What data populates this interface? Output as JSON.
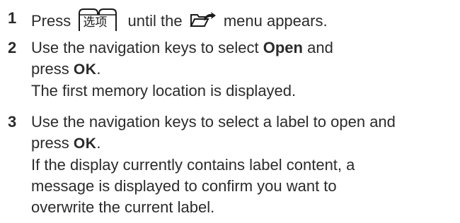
{
  "steps": [
    {
      "number": "1",
      "parts": {
        "before": "Press",
        "key_text": "选项",
        "after": "until the",
        "end": "menu appears."
      }
    },
    {
      "number": "2",
      "lines": {
        "pre": "Use the navigation keys to select",
        "open": "Open",
        "post": "and",
        "press": "press",
        "ok": "OK",
        "dot": ".",
        "result": "The first memory location is displayed."
      }
    },
    {
      "number": "3",
      "lines": {
        "l1": "Use the navigation keys to select a label to open and",
        "press": "press",
        "ok": "OK",
        "dot": ".",
        "l3": "If the display currently contains label content, a",
        "l4": "message is displayed to confirm you want to",
        "l5": "overwrite the current label."
      }
    }
  ],
  "icons": {
    "options_key": "options-key-icon",
    "file_menu": "file-open-menu-icon"
  }
}
